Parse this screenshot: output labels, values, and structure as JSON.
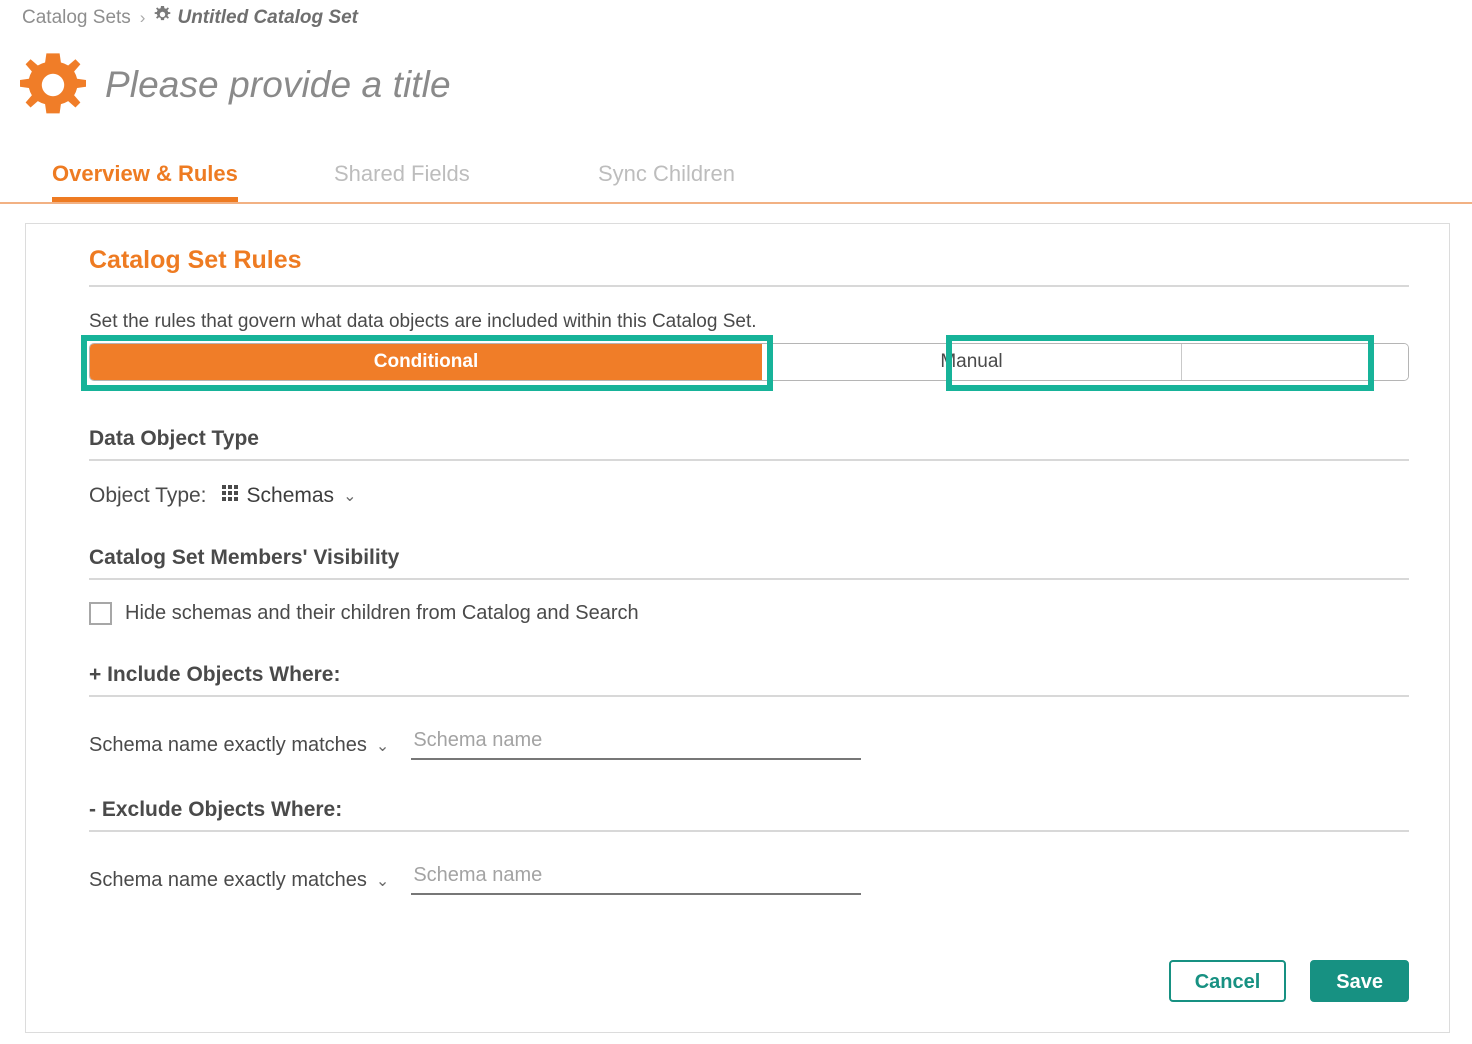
{
  "breadcrumb": {
    "root": "Catalog Sets",
    "separator": "›",
    "current": "Untitled Catalog Set",
    "gear_icon": "gear-icon"
  },
  "header": {
    "gear_icon": "gear-icon",
    "title": "Please provide a title"
  },
  "tabs": [
    {
      "label": "Overview & Rules",
      "active": true
    },
    {
      "label": "Shared Fields",
      "active": false
    },
    {
      "label": "Sync Children",
      "active": false
    }
  ],
  "main": {
    "section_title": "Catalog Set Rules",
    "intro": "Set the rules that govern what data objects are included within this Catalog Set.",
    "mode_toggle": {
      "options": [
        "Conditional",
        "Manual"
      ],
      "selected": "Conditional",
      "highlight_color": "#17b399"
    },
    "data_object_type": {
      "heading": "Data Object Type",
      "label": "Object Type:",
      "icon": "grid-icon",
      "value": "Schemas",
      "chevron": "⌄"
    },
    "visibility": {
      "heading": "Catalog Set Members' Visibility",
      "checkbox_label": "Hide schemas and their children from Catalog and Search",
      "checked": false
    },
    "include": {
      "heading": "+ Include Objects Where:",
      "condition": "Schema name exactly matches",
      "chevron": "⌄",
      "input_value": "",
      "input_placeholder": "Schema name"
    },
    "exclude": {
      "heading": "- Exclude Objects Where:",
      "condition": "Schema name exactly matches",
      "chevron": "⌄",
      "input_value": "",
      "input_placeholder": "Schema name"
    },
    "footer": {
      "cancel_label": "Cancel",
      "save_label": "Save"
    }
  },
  "colors": {
    "accent_orange": "#ee7b22",
    "teal": "#179182",
    "highlight_teal": "#17b399"
  }
}
